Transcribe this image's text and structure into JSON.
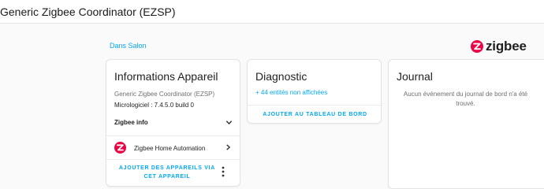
{
  "header": {
    "title": "Generic Zigbee Coordinator (EZSP)"
  },
  "breadcrumb": {
    "area": "Dans Salon"
  },
  "brand": {
    "name": "zigbee",
    "accent": "#eb0443"
  },
  "device_info": {
    "title": "Informations Appareil",
    "model": "Generic Zigbee Coordinator (EZSP)",
    "firmware": "Micrologiciel : 7.4.5.0 build 0",
    "zigbee_info_label": "Zigbee info",
    "integration_label": "Zigbee Home Automation",
    "add_devices_label": "AJOUTER DES APPAREILS VIA CET APPAREIL"
  },
  "diagnostic": {
    "title": "Diagnostic",
    "hidden_entities": "+ 44 entités non affichées",
    "add_dashboard_label": "AJOUTER AU TABLEAU DE BORD"
  },
  "journal": {
    "title": "Journal",
    "empty_message": "Aucun événement du journal de bord n'a été trouvé."
  },
  "colors": {
    "link": "#03a9f4",
    "card_bg": "#ffffff",
    "page_bg": "#fafafa"
  }
}
